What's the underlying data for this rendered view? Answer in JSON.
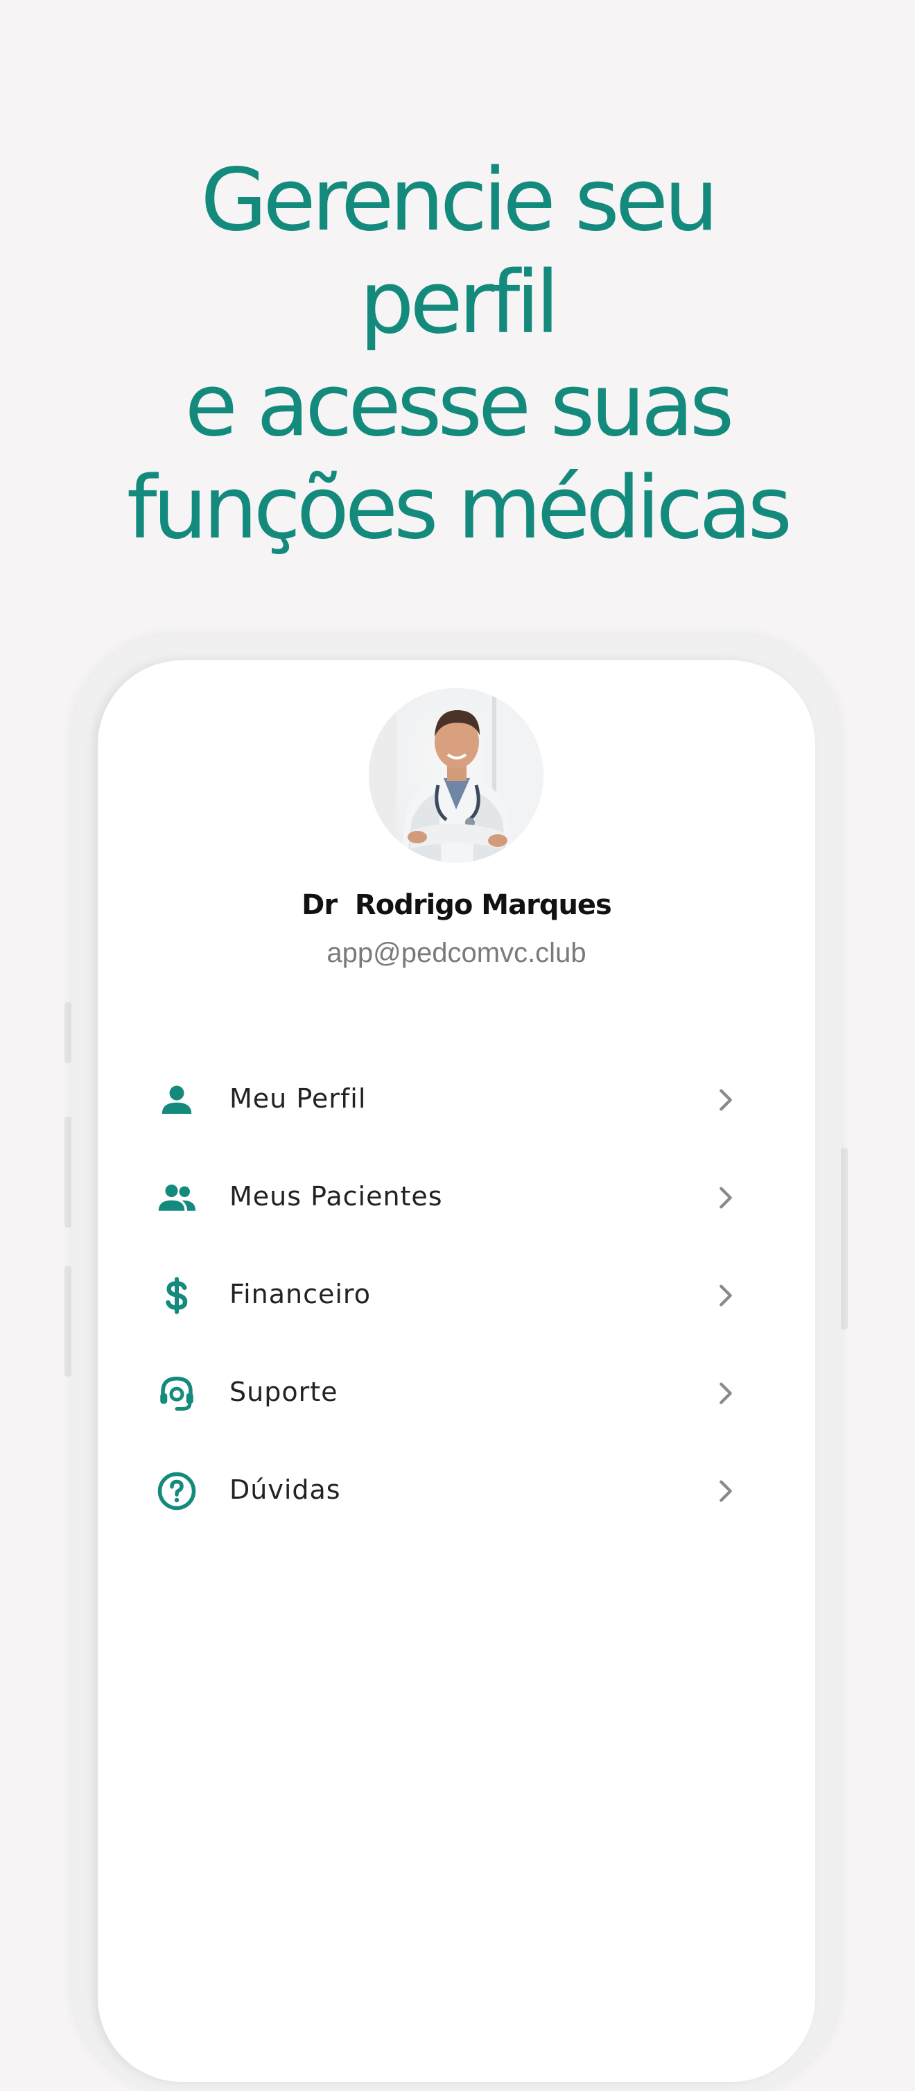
{
  "headline": {
    "line1": "Gerencie seu",
    "line2": "perfil",
    "line3": "e acesse suas",
    "line4": "funções médicas"
  },
  "profile": {
    "name": "Dr  Rodrigo Marques",
    "email": "app@pedcomvc.club"
  },
  "menu": {
    "items": [
      {
        "label": "Meu Perfil",
        "icon": "person-icon"
      },
      {
        "label": "Meus Pacientes",
        "icon": "people-icon"
      },
      {
        "label": "Financeiro",
        "icon": "dollar-icon"
      },
      {
        "label": "Suporte",
        "icon": "headset-icon"
      },
      {
        "label": "Dúvidas",
        "icon": "help-circle-icon"
      }
    ]
  },
  "colors": {
    "accent": "#138a7c",
    "background": "#f6f4f5",
    "text": "#222222",
    "muted": "#7a7a7a",
    "chevron": "#8a8a8a"
  }
}
